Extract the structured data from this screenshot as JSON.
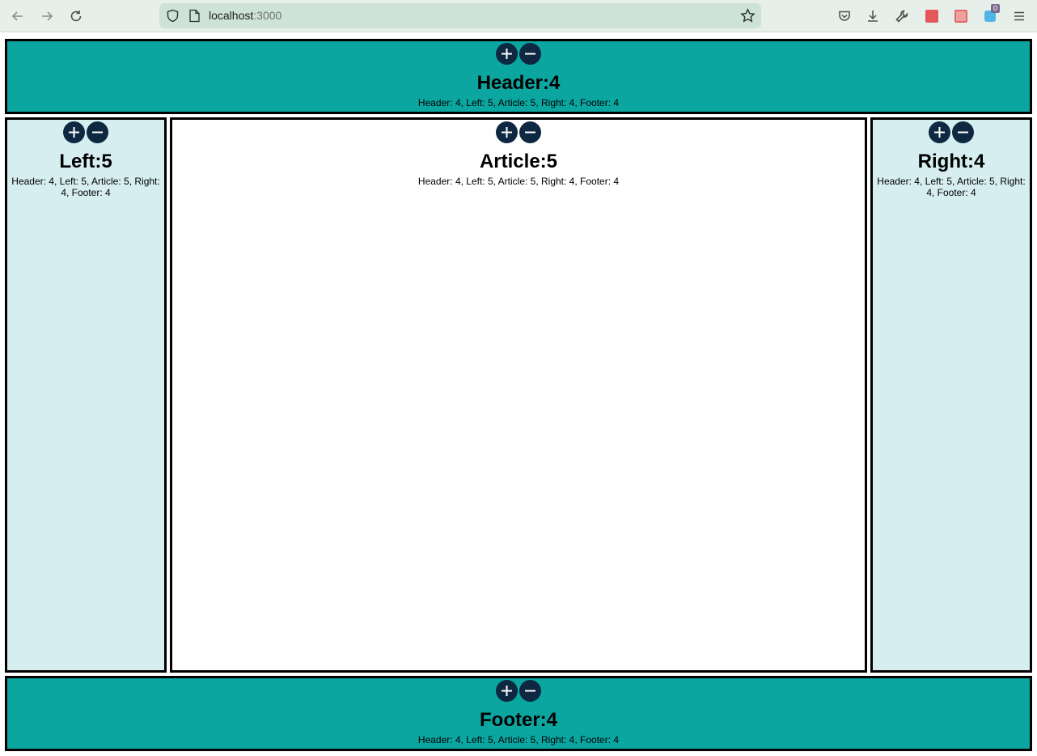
{
  "browser": {
    "url_host": "localhost",
    "url_port": ":3000",
    "extension_badge": "0"
  },
  "header": {
    "title": "Header:4",
    "status": "Header: 4, Left: 5, Article: 5, Right: 4, Footer: 4"
  },
  "left": {
    "title": "Left:5",
    "status": "Header: 4, Left: 5, Article: 5, Right: 4, Footer: 4"
  },
  "article": {
    "title": "Article:5",
    "status": "Header: 4, Left: 5, Article: 5, Right: 4, Footer: 4"
  },
  "right": {
    "title": "Right:4",
    "status": "Header: 4, Left: 5, Article: 5, Right: 4, Footer: 4"
  },
  "footer": {
    "title": "Footer:4",
    "status": "Header: 4, Left: 5, Article: 5, Right: 4, Footer: 4"
  },
  "colors": {
    "teal": "#0ca6a1",
    "light": "#d6eeef",
    "button": "#0d2840"
  }
}
